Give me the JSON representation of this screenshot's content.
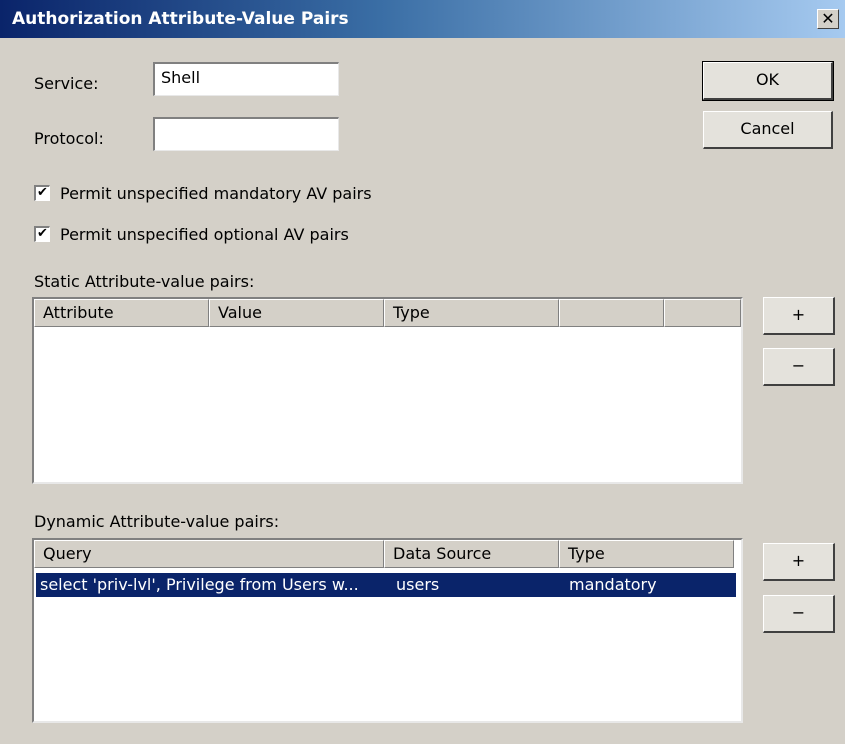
{
  "window": {
    "title": "Authorization Attribute-Value Pairs",
    "close_glyph": "✕"
  },
  "form": {
    "service_label": "Service:",
    "service_value": "Shell",
    "protocol_label": "Protocol:",
    "protocol_value": ""
  },
  "buttons": {
    "ok": "OK",
    "cancel": "Cancel",
    "add": "+",
    "remove": "−"
  },
  "checkboxes": [
    {
      "label": "Permit unspecified mandatory AV pairs",
      "checked": true,
      "mark": "✔"
    },
    {
      "label": "Permit unspecified optional AV pairs",
      "checked": true,
      "mark": "✔"
    }
  ],
  "static_pairs": {
    "label": "Static Attribute-value pairs:",
    "columns": [
      "Attribute",
      "Value",
      "Type",
      "",
      ""
    ],
    "rows": []
  },
  "dynamic_pairs": {
    "label": "Dynamic Attribute-value pairs:",
    "columns": [
      "Query",
      "Data Source",
      "Type"
    ],
    "rows": [
      {
        "query": "select 'priv-lvl', Privilege from Users w...",
        "source": "users",
        "type": "mandatory",
        "selected": true
      }
    ]
  },
  "colors": {
    "dialog_bg": "#d4d0c8",
    "title_start": "#0a246a",
    "title_end": "#a6caf0",
    "selection": "#0a246a"
  }
}
